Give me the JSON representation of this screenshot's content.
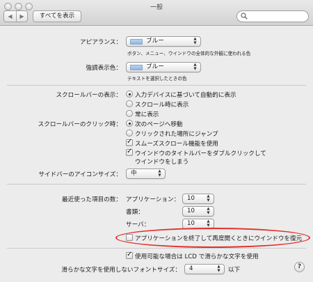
{
  "window": {
    "title": "一般"
  },
  "toolbar": {
    "back_label": "◀",
    "forward_label": "▶",
    "show_all_label": "すべてを表示",
    "search_placeholder": ""
  },
  "appearance": {
    "label": "アピアランス：",
    "value": "ブルー",
    "description": "ボタン、メニュー、ウインドウの全体的な外観に使われる色"
  },
  "highlight_color": {
    "label": "強調表示色：",
    "value": "ブルー",
    "description": "テキストを選択したときの色"
  },
  "scrollbar_show": {
    "label": "スクロールバーの表示：",
    "options": [
      {
        "label": "入力デバイスに基づいて自動的に表示",
        "selected": true
      },
      {
        "label": "スクロール時に表示",
        "selected": false
      },
      {
        "label": "常に表示",
        "selected": false
      }
    ]
  },
  "scrollbar_click": {
    "label": "スクロールバーのクリック時：",
    "options": [
      {
        "label": "次のページへ移動",
        "selected": true
      },
      {
        "label": "クリックされた場所にジャンプ",
        "selected": false
      }
    ]
  },
  "smooth_scroll": {
    "label": "スムーズスクロール機能を使用",
    "checked": true
  },
  "double_click_minimize": {
    "line1": "ウインドウのタイトルバーをダブルクリックして",
    "line2": "ウインドウをしまう",
    "checked": true
  },
  "sidebar_icon_size": {
    "label": "サイドバーのアイコンサイズ：",
    "value": "中"
  },
  "recent_items": {
    "label": "最近使った項目の数：",
    "rows": [
      {
        "label": "アプリケーション：",
        "value": "10"
      },
      {
        "label": "書類：",
        "value": "10"
      },
      {
        "label": "サーバ：",
        "value": "10"
      }
    ]
  },
  "restore_windows": {
    "label": "アプリケーションを終了して再度開くときにウインドウを復元",
    "checked": false
  },
  "lcd_smoothing": {
    "label": "使用可能な場合は LCD で滑らかな文字を使用",
    "checked": true
  },
  "font_smoothing": {
    "label": "滑らかな文字を使用しないフォントサイズ：",
    "value": "4",
    "suffix": "以下"
  },
  "help": {
    "label": "?"
  },
  "colors": {
    "accent_swatch": "#a9c8ec",
    "highlight_ring": "#e2302a"
  }
}
